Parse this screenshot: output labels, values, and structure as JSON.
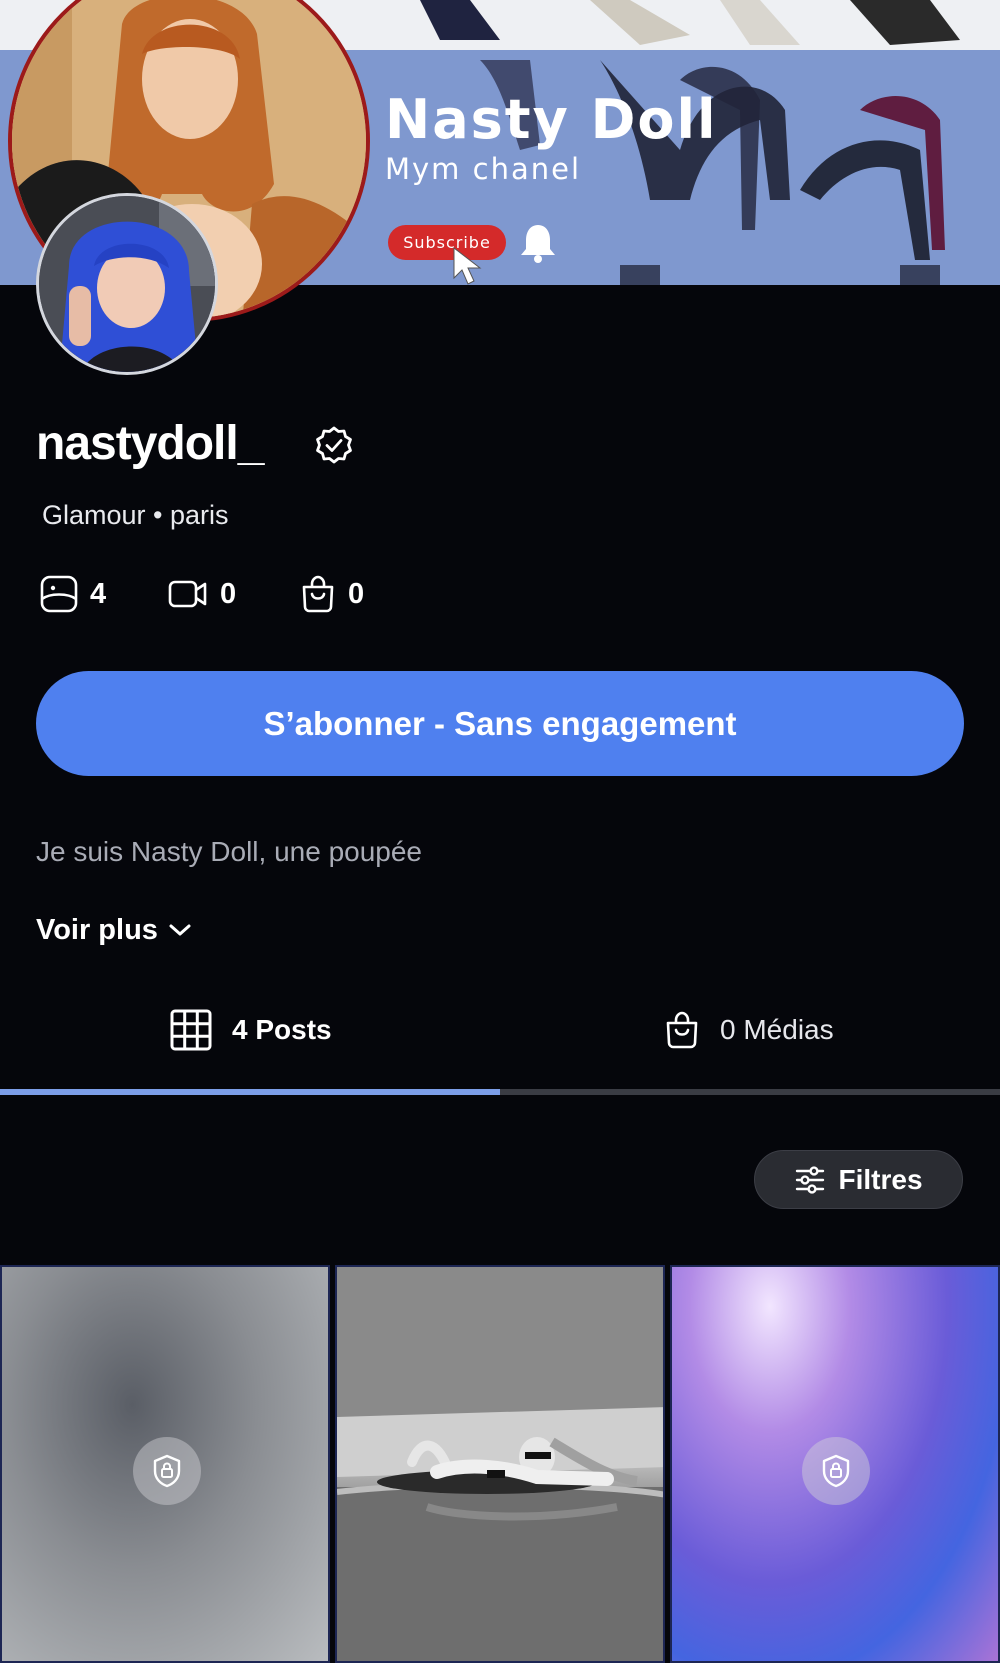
{
  "banner": {
    "title": "Nasty Doll",
    "subtitle": "Mym chanel",
    "subscribe_label": "Subscribe"
  },
  "profile": {
    "username": "nastydoll_",
    "subtitle": "Glamour • paris",
    "stats": {
      "photos": "4",
      "videos": "0",
      "shop": "0"
    },
    "subscribe_button": "S’abonner - Sans engagement",
    "bio": "Je suis Nasty Doll, une poupée",
    "voir_plus": "Voir plus"
  },
  "tabs": {
    "posts": "4 Posts",
    "medias": "0 Médias",
    "active": "posts"
  },
  "filters": {
    "label": "Filtres"
  },
  "grid": [
    {
      "type": "locked"
    },
    {
      "type": "photo"
    },
    {
      "type": "locked"
    }
  ],
  "colors": {
    "background": "#05060b",
    "accent": "#4f80ef",
    "tab_active": "#7c9ee8",
    "banner": "#7f98cf",
    "banner_subscribe": "#d42a2a"
  }
}
